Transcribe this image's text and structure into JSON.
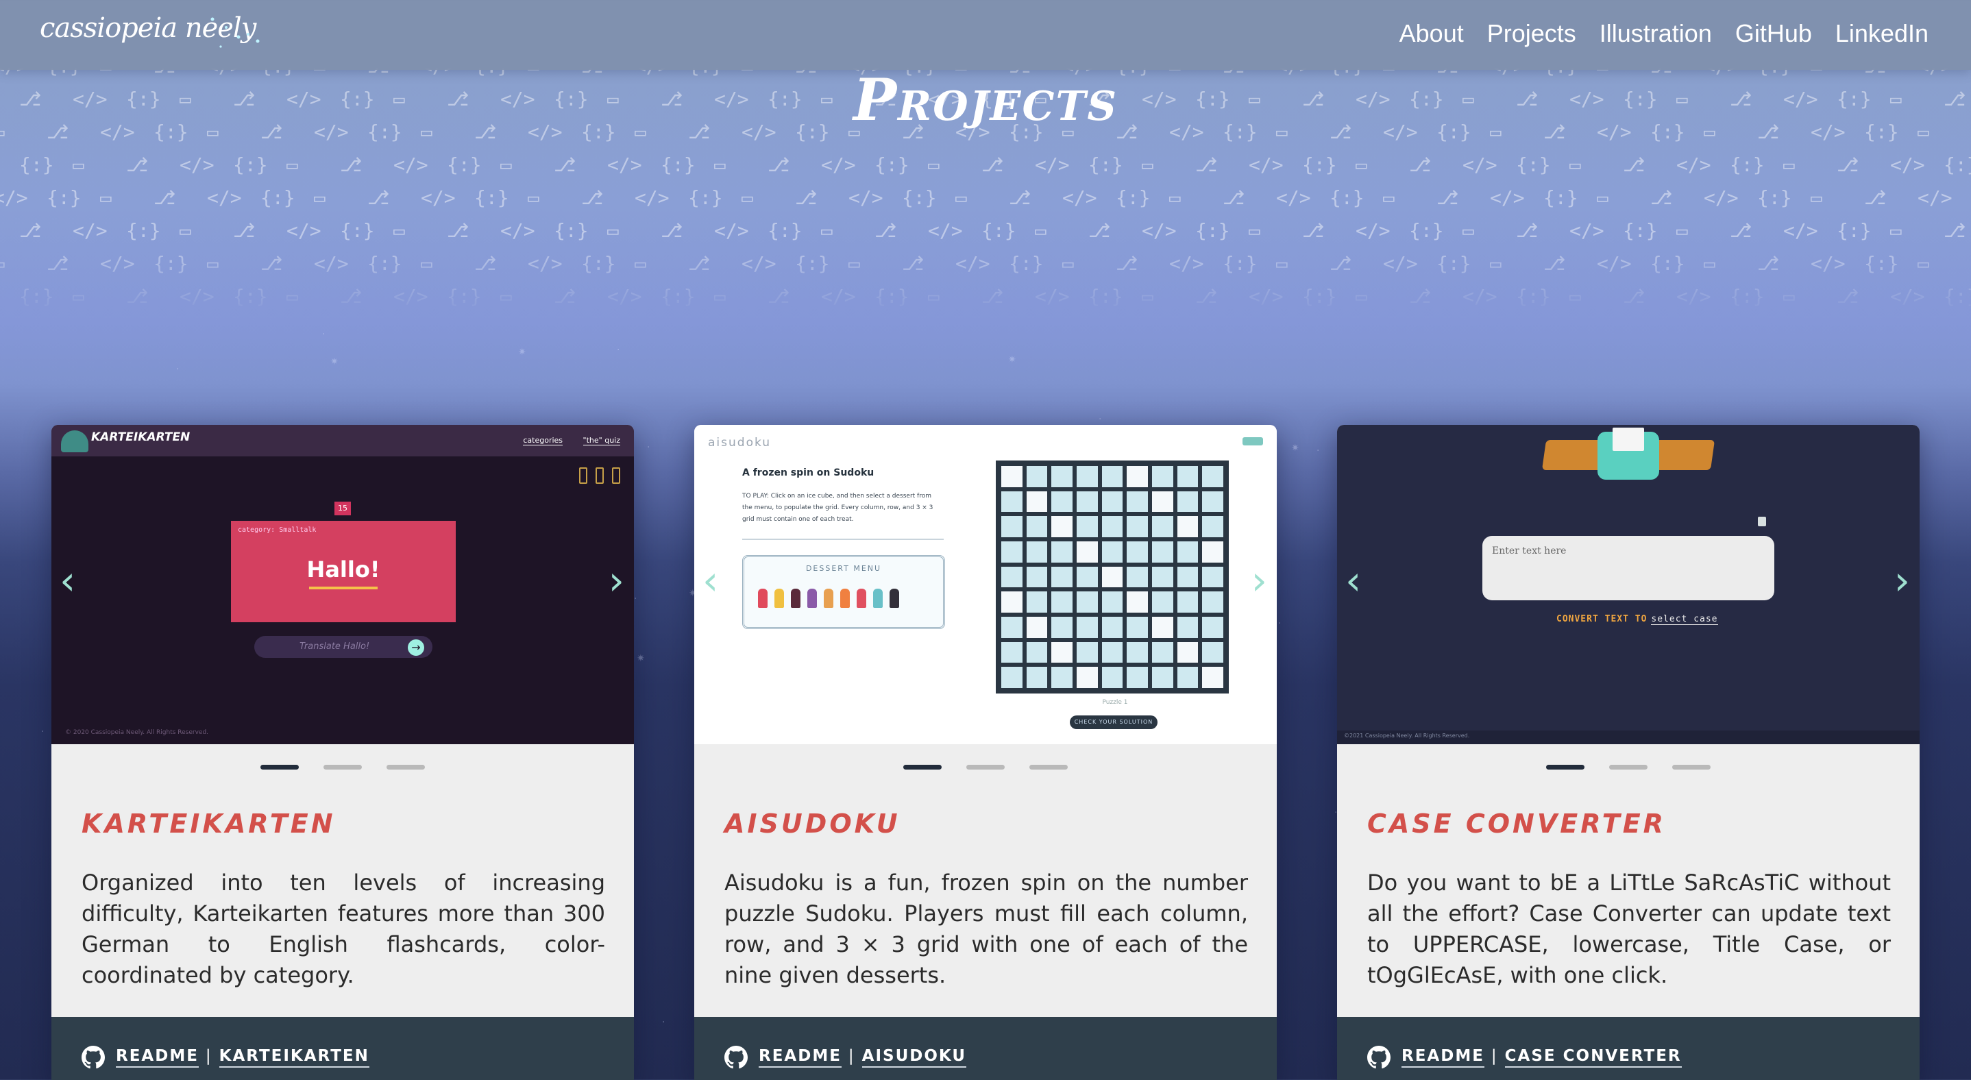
{
  "header": {
    "logo_text": "cassiopeia neely",
    "nav": [
      "About",
      "Projects",
      "Illustration",
      "GitHub",
      "LinkedIn"
    ]
  },
  "page_title": "Projects",
  "pattern_glyphs": [
    "</>",
    "{:}",
    "folder-icon",
    "git-branch-icon"
  ],
  "cards": [
    {
      "title": "KARTEIKARTEN",
      "description": "Organized into ten levels of increasing difficulty, Karteikarten features more than 300 German to English flashcards, color-coordinated by category.",
      "readme_label": "README",
      "repo_label": "KARTEIKARTEN",
      "slide_count": 3,
      "active_slide": 1,
      "screenshot": {
        "brand": "KARTEIKARTEN",
        "menu": [
          "categories",
          "\"the\" quiz"
        ],
        "badge": "15",
        "category": "category: Smalltalk",
        "word": "Hallo!",
        "input_placeholder": "Translate Hallo!",
        "copyright": "© 2020 Cassiopeia Neely. All Rights Reserved."
      }
    },
    {
      "title": "AISUDOKU",
      "description": "Aisudoku is a fun, frozen spin on the number puzzle Sudoku. Players must fill each column, row, and 3 × 3 grid with one of each of the nine given desserts.",
      "readme_label": "README",
      "repo_label": "AISUDOKU",
      "slide_count": 3,
      "active_slide": 1,
      "screenshot": {
        "brand": "aisudoku",
        "heading": "A frozen spin on Sudoku",
        "instructions": "TO PLAY: Click on an ice cube, and then select a dessert from the menu, to populate the grid. Every column, row, and 3 × 3 grid must contain one of each treat.",
        "menu_title": "DESSERT MENU",
        "puzzle_label": "Puzzle 1",
        "check_button": "CHECK YOUR SOLUTION"
      }
    },
    {
      "title": "CASE CONVERTER",
      "description": "Do you want to bE a LiTtLe SaRcAsTiC without all the effort? Case Converter can update text to UPPERCASE, lowercase, Title Case, or tOgGlEcAsE, with one click.",
      "readme_label": "README",
      "repo_label": "CASE CONVERTER",
      "slide_count": 3,
      "active_slide": 1,
      "screenshot": {
        "textarea_placeholder": "Enter text here",
        "convert_label": "CONVERT TEXT TO",
        "select_value": "select case",
        "copyright": "©2021 Cassiopeia Neely. All Rights Reserved."
      }
    }
  ],
  "colors": {
    "title_red": "#d3504a",
    "arrow_mint": "#9fe0d0",
    "footer_slate": "#2f3f4b",
    "header_bar": "#7f8fac"
  }
}
